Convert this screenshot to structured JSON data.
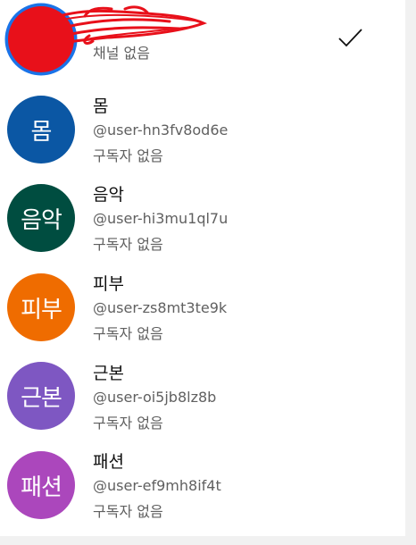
{
  "accounts": [
    {
      "avatar_text": "",
      "avatar_color": "#1a73e8",
      "name": "",
      "handle": "",
      "subscribers": "채널 없음",
      "selected": true
    },
    {
      "avatar_text": "몸",
      "avatar_color": "#0b57a4",
      "name": "몸",
      "handle": "@user-hn3fv8od6e",
      "subscribers": "구독자 없음"
    },
    {
      "avatar_text": "음악",
      "avatar_color": "#004d40",
      "name": "음악",
      "handle": "@user-hi3mu1ql7u",
      "subscribers": "구독자 없음"
    },
    {
      "avatar_text": "피부",
      "avatar_color": "#ef6c00",
      "name": "피부",
      "handle": "@user-zs8mt3te9k",
      "subscribers": "구독자 없음"
    },
    {
      "avatar_text": "근본",
      "avatar_color": "#7e57c2",
      "name": "근본",
      "handle": "@user-oi5jb8lz8b",
      "subscribers": "구독자 없음"
    },
    {
      "avatar_text": "패션",
      "avatar_color": "#ab47bc",
      "name": "패션",
      "handle": "@user-ef9mh8if4t",
      "subscribers": "구독자 없음"
    }
  ],
  "icons": {
    "selected": "checkmark-icon"
  },
  "colors": {
    "redaction": "#e8101a",
    "text_primary": "#0f0f0f",
    "text_secondary": "#606060"
  }
}
